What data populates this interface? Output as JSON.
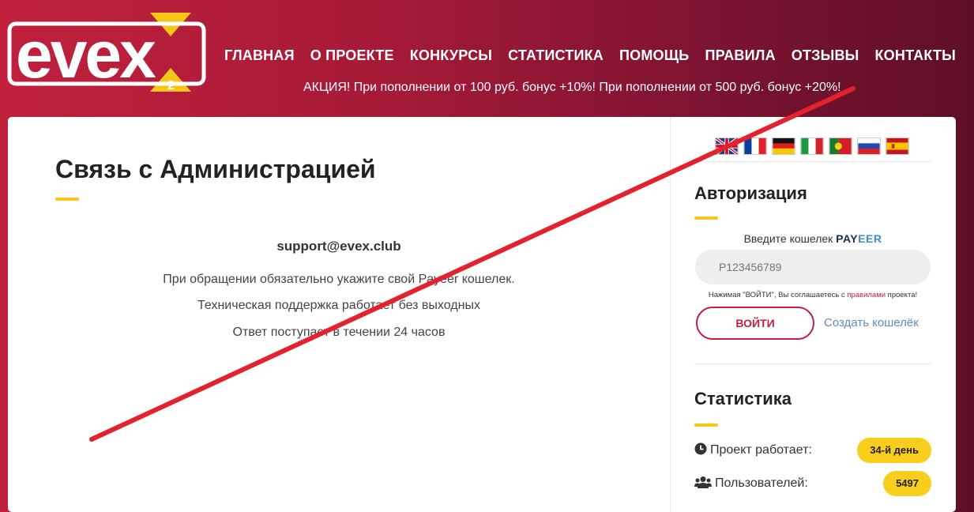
{
  "brand": {
    "logo_text": "evex",
    "logo_badge": "2"
  },
  "nav": [
    "ГЛАВНАЯ",
    "О ПРОЕКТЕ",
    "КОНКУРСЫ",
    "СТАТИСТИКА",
    "ПОМОЩЬ",
    "ПРАВИЛА",
    "ОТЗЫВЫ",
    "КОНТАКТЫ"
  ],
  "promo": "АКЦИЯ! При пополнении от 100 руб. бонус +10%! При пополнении от 500 руб. бонус +20%!",
  "main": {
    "title": "Связь с Администрацией",
    "email": "support@evex.club",
    "lines": [
      "При обращении обязательно укажите свой Payeer кошелек.",
      "Техническая поддержка работает без выходных",
      "Ответ поступает в течении 24 часов"
    ]
  },
  "sidebar": {
    "languages": [
      "en-flag-icon",
      "fr-flag-icon",
      "de-flag-icon",
      "it-flag-icon",
      "pt-flag-icon",
      "ru-flag-icon",
      "es-flag-icon"
    ],
    "auth": {
      "title": "Авторизация",
      "wallet_label": "Введите кошелек",
      "payeer_pay": "PAY",
      "payeer_eer": "EER",
      "placeholder": "P123456789",
      "note_pre": "Нажимая \"ВОЙТИ\", Вы соглашаетесь с ",
      "note_link": "правилами",
      "note_post": " проекта!",
      "login_label": "ВОЙТИ",
      "create_label": "Создать кошелёк"
    },
    "stats": {
      "title": "Статистика",
      "rows": [
        {
          "label": "Проект работает:",
          "value": "34-й день"
        },
        {
          "label": "Пользователей:",
          "value": "5497"
        }
      ]
    }
  },
  "colors": {
    "brand_red": "#c0213c",
    "accent_yellow": "#f5c518",
    "link_blue": "#5b8fc4"
  }
}
